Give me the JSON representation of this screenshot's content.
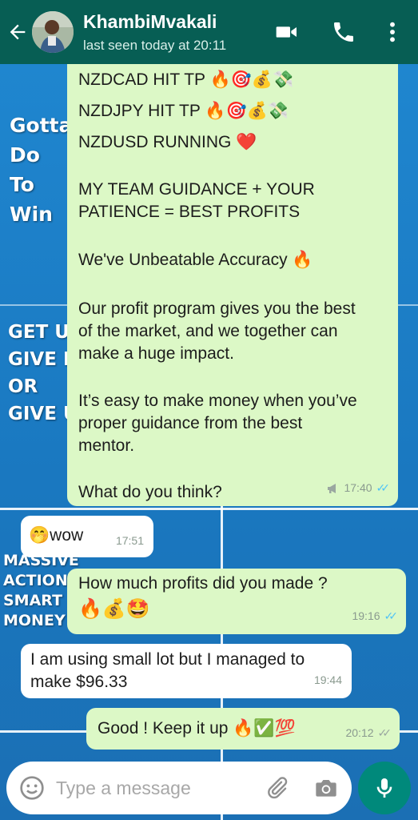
{
  "header": {
    "contact_name": "KhambiMvakali",
    "status": "last seen today at 20:11"
  },
  "wallpaper": {
    "text_1": [
      "Gotta",
      "Do",
      "To",
      "Win"
    ],
    "text_2": [
      "GET UP",
      "GIVE IT",
      "OR",
      "GIVE UP"
    ],
    "text_3": [
      "MASSIVE",
      "ACTION",
      "SMART",
      "MONEY"
    ]
  },
  "messages": [
    {
      "direction": "outgoing",
      "lines": [
        "NZDCAD HIT TP 🔥🎯💰💸",
        "NZDJPY HIT TP 🔥🎯💰💸",
        "NZDUSD RUNNING ❤️",
        "",
        "MY TEAM GUIDANCE + YOUR",
        "PATIENCE = BEST PROFITS",
        "",
        "We've Unbeatable Accuracy 🔥",
        "",
        "Our profit program gives you the best",
        "of the market, and we together can",
        "make a huge impact.",
        "",
        "It’s easy to make money when you’ve",
        "proper guidance from the best",
        "mentor.",
        "",
        "What do you think?"
      ],
      "time": "17:40",
      "status": "read"
    },
    {
      "direction": "incoming",
      "lines": [
        "🤭wow"
      ],
      "time": "17:51"
    },
    {
      "direction": "outgoing",
      "lines": [
        "How much profits did you made ?",
        "🔥💰🤩"
      ],
      "time": "19:16",
      "status": "read"
    },
    {
      "direction": "incoming",
      "lines": [
        "I am using small lot but I managed to",
        "make $96.33"
      ],
      "time": "19:44"
    },
    {
      "direction": "outgoing",
      "lines": [
        "Good ! Keep it up 🔥✅💯"
      ],
      "time": "20:12",
      "status": "delivered"
    }
  ],
  "composer": {
    "placeholder": "Type a message"
  },
  "icons": {
    "back": "back-arrow-icon",
    "video": "video-call-icon",
    "call": "phone-icon",
    "menu": "more-vert-icon",
    "emoji": "emoji-icon",
    "attach": "paperclip-icon",
    "camera": "camera-icon",
    "mic": "mic-icon"
  },
  "colors": {
    "header": "#075e54",
    "outgoing_bubble": "#dcf8c6",
    "incoming_bubble": "#ffffff",
    "read_ticks": "#4fc3f7",
    "mic_button": "#00897b"
  }
}
